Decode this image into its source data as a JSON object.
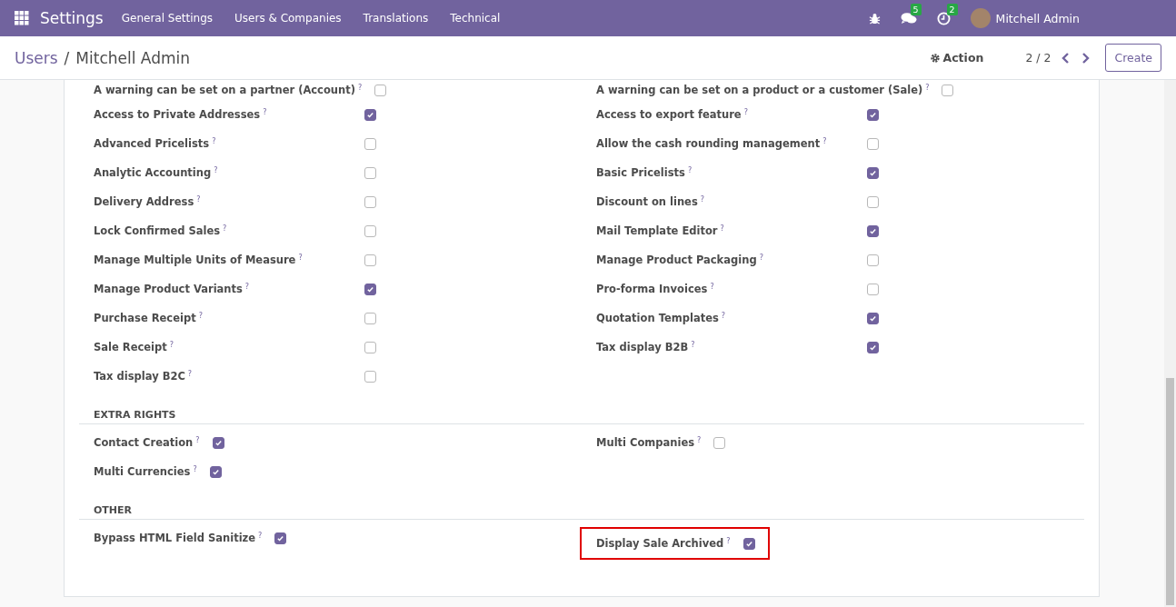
{
  "navbar": {
    "app_name": "Settings",
    "menus": [
      "General Settings",
      "Users & Companies",
      "Translations",
      "Technical"
    ],
    "systray": [
      {
        "kind": "bug"
      },
      {
        "kind": "chat",
        "badge": "5"
      },
      {
        "kind": "clock",
        "badge": "2"
      }
    ],
    "user": {
      "name": "Mitchell Admin"
    }
  },
  "control_panel": {
    "breadcrumbs": [
      {
        "label": "Users",
        "link": true
      },
      {
        "label": "/",
        "link": false
      },
      {
        "label": "Mitchell Admin",
        "link": false
      }
    ],
    "action": "Action",
    "pager": "2 / 2",
    "create": "Create"
  },
  "sections": [
    {
      "kind": "grid",
      "columns": [
        [
          {
            "label": "A warning can be set on a partner (Account)",
            "help": "?",
            "checked": false
          },
          {
            "label": "Access to Private Addresses",
            "help": "?",
            "checked": true
          },
          {
            "label": "Advanced Pricelists",
            "help": "?",
            "checked": false
          },
          {
            "label": "Analytic Accounting",
            "help": "?",
            "checked": false
          },
          {
            "label": "Delivery Address",
            "help": "?",
            "checked": false
          },
          {
            "label": "Lock Confirmed Sales",
            "help": "?",
            "checked": false
          },
          {
            "label": "Manage Multiple Units of Measure",
            "help": "?",
            "checked": false
          },
          {
            "label": "Manage Product Variants",
            "help": "?",
            "checked": true
          },
          {
            "label": "Purchase Receipt",
            "help": "?",
            "checked": false
          },
          {
            "label": "Sale Receipt",
            "help": "?",
            "checked": false
          },
          {
            "label": "Tax display B2C",
            "help": "?",
            "checked": false
          }
        ],
        [
          {
            "label": "A warning can be set on a product or a customer (Sale)",
            "help": "?",
            "checked": false
          },
          {
            "label": "Access to export feature",
            "help": "?",
            "checked": true
          },
          {
            "label": "Allow the cash rounding management",
            "help": "?",
            "checked": false
          },
          {
            "label": "Basic Pricelists",
            "help": "?",
            "checked": true
          },
          {
            "label": "Discount on lines",
            "help": "?",
            "checked": false
          },
          {
            "label": "Mail Template Editor",
            "help": "?",
            "checked": true
          },
          {
            "label": "Manage Product Packaging",
            "help": "?",
            "checked": false
          },
          {
            "label": "Pro-forma Invoices",
            "help": "?",
            "checked": false
          },
          {
            "label": "Quotation Templates",
            "help": "?",
            "checked": true
          },
          {
            "label": "Tax display B2B",
            "help": "?",
            "checked": true
          }
        ]
      ]
    },
    {
      "kind": "inline",
      "title": "EXTRA RIGHTS",
      "columns": [
        [
          {
            "label": "Contact Creation",
            "help": "?",
            "checked": true
          },
          {
            "label": "Multi Currencies",
            "help": "?",
            "checked": true
          }
        ],
        [
          {
            "label": "Multi Companies",
            "help": "?",
            "checked": false
          }
        ]
      ]
    },
    {
      "kind": "inline",
      "title": "OTHER",
      "columns": [
        [
          {
            "label": "Bypass HTML Field Sanitize",
            "help": "?",
            "checked": true
          }
        ],
        [
          {
            "label": "Display Sale Archived",
            "help": "?",
            "checked": true,
            "highlighted": true
          }
        ]
      ]
    }
  ]
}
